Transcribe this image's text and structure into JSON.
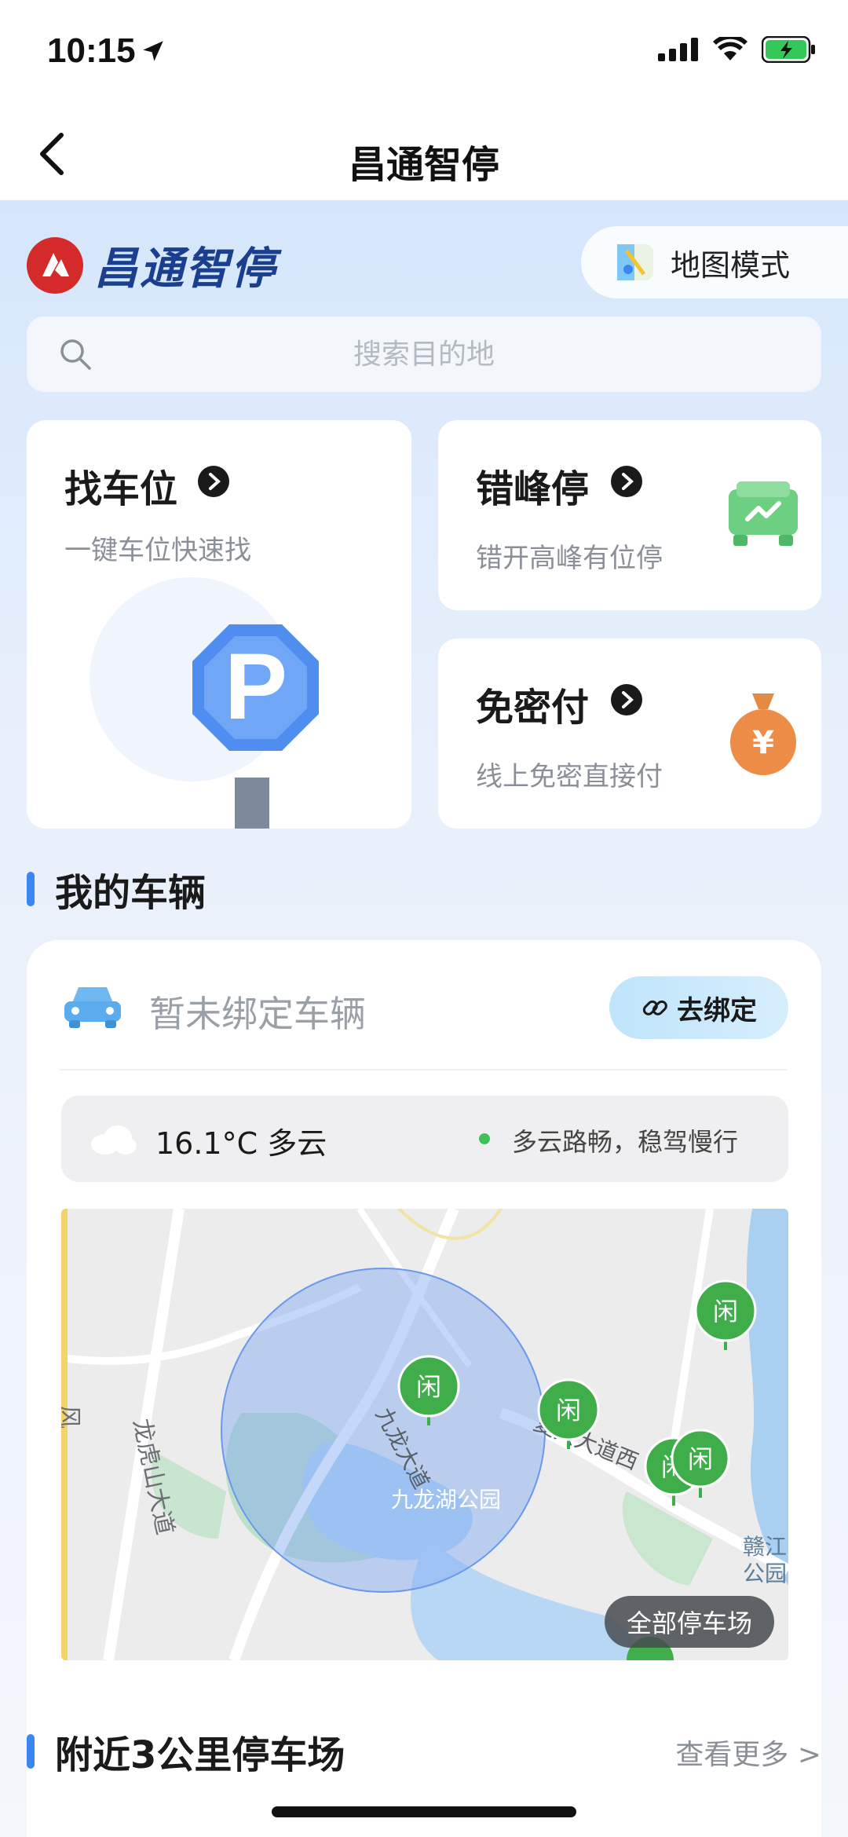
{
  "status_bar": {
    "time": "10:15"
  },
  "nav": {
    "title": "昌通智停"
  },
  "brand": {
    "name": "昌通智停",
    "map_mode_label": "地图模式"
  },
  "search": {
    "placeholder": "搜索目的地"
  },
  "features": [
    {
      "title": "找车位",
      "subtitle": "一键车位快速找"
    },
    {
      "title": "错峰停",
      "subtitle": "错开高峰有位停"
    },
    {
      "title": "免密付",
      "subtitle": "线上免密直接付"
    }
  ],
  "my_vehicles": {
    "section_title": "我的车辆",
    "empty_text": "暂未绑定车辆",
    "bind_label": "去绑定",
    "weather": {
      "temp": "16.1°C 多云",
      "advice": "多云路畅，稳驾慢行"
    },
    "map": {
      "roads": [
        "龙虎山大道",
        "九龙大道",
        "复兴大道西",
        "九龙湖公园",
        "赣江公园",
        "风"
      ],
      "marker_label": "闲",
      "all_parking_label": "全部停车场"
    }
  },
  "nearby": {
    "section_title": "附近3公里停车场",
    "more_label": "查看更多 >"
  },
  "colors": {
    "accent": "#3a86f4",
    "marker_green": "#3fae4a",
    "brand_red": "#d42a2a",
    "brand_blue": "#1b3f8f"
  }
}
